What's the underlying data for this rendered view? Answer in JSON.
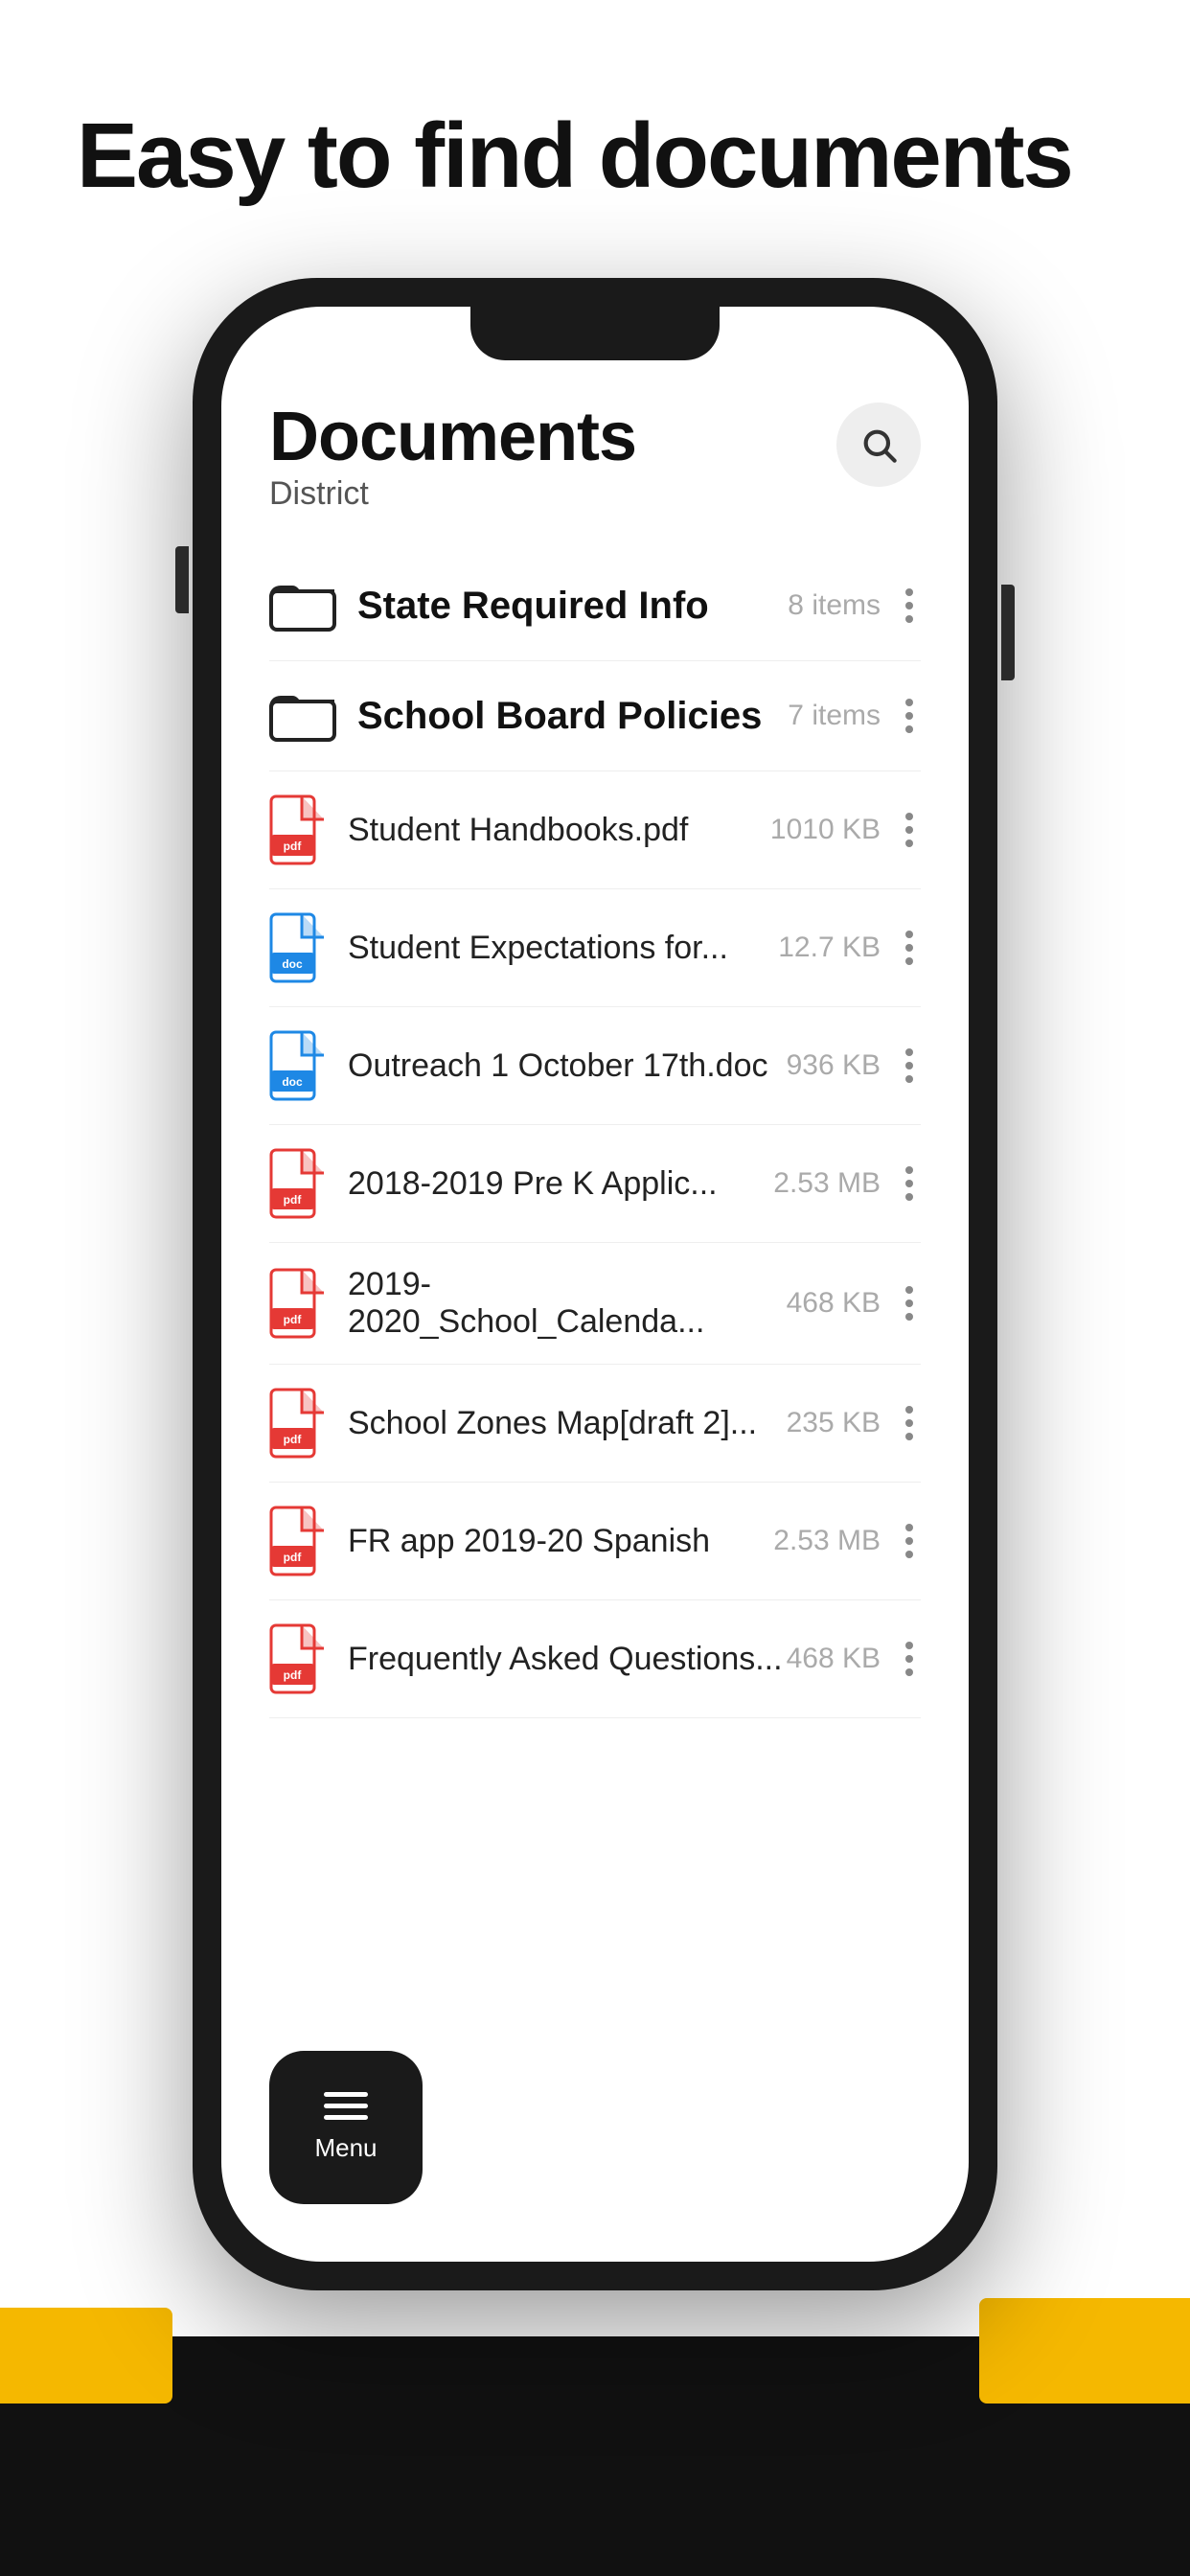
{
  "hero": {
    "title": "Easy to find documents"
  },
  "screen": {
    "page_title": "Documents",
    "page_subtitle": "District",
    "search_label": "Search"
  },
  "folders": [
    {
      "name": "State Required Info",
      "count": "8 items"
    },
    {
      "name": "School Board Policies",
      "count": "7 items"
    }
  ],
  "files": [
    {
      "name": "Student Handbooks.pdf",
      "size": "1010 KB",
      "type": "pdf"
    },
    {
      "name": "Student Expectations for...",
      "size": "12.7 KB",
      "type": "doc"
    },
    {
      "name": "Outreach 1 October 17th.doc",
      "size": "936 KB",
      "type": "doc"
    },
    {
      "name": "2018-2019 Pre K Applic...",
      "size": "2.53 MB",
      "type": "pdf"
    },
    {
      "name": "2019-2020_School_Calenda...",
      "size": "468 KB",
      "type": "pdf"
    },
    {
      "name": "School Zones Map[draft 2]...",
      "size": "235 KB",
      "type": "pdf"
    },
    {
      "name": "FR app 2019-20 Spanish",
      "size": "2.53 MB",
      "type": "pdf"
    },
    {
      "name": "Frequently Asked Questions...",
      "size": "468 KB",
      "type": "pdf"
    }
  ],
  "menu": {
    "label": "Menu"
  },
  "colors": {
    "accent_yellow": "#f5b800",
    "dark": "#1a1a1a",
    "pdf_red": "#e53935",
    "doc_blue": "#1e88e5"
  }
}
